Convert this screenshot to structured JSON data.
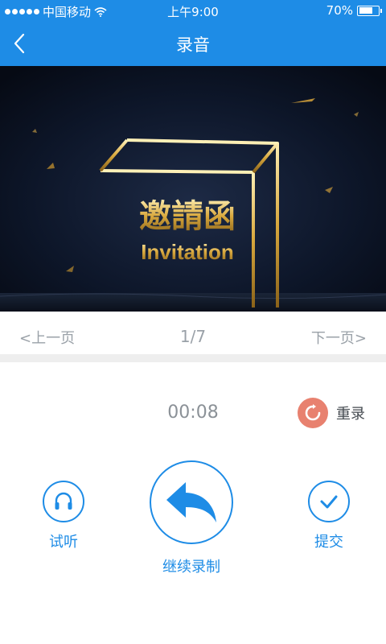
{
  "status_bar": {
    "carrier": "中国移动",
    "time": "上午9:00",
    "battery": "70%",
    "battery_level": 0.7
  },
  "nav": {
    "title": "录音"
  },
  "hero": {
    "title": "邀請函",
    "subtitle": "Invitation"
  },
  "pager": {
    "prev": "<上一页",
    "page": "1/7",
    "next": "下一页>"
  },
  "recorder": {
    "timer": "00:08",
    "rerecord": "重录",
    "listen": "试听",
    "continue": "继续录制",
    "submit": "提交"
  },
  "colors": {
    "accent": "#1e8ce6",
    "rerecord_icon": "#e8816f",
    "muted_text": "#9aa1a8"
  }
}
